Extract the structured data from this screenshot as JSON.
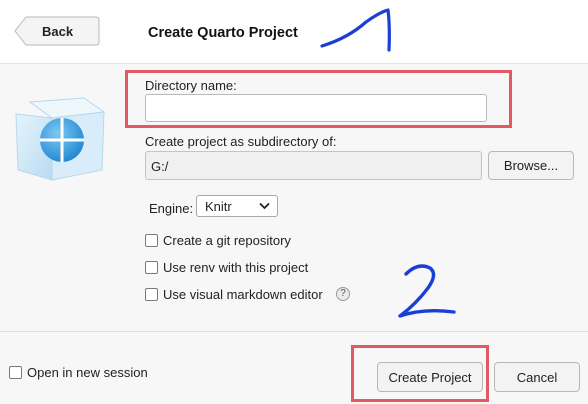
{
  "header": {
    "back_label": "Back",
    "title": "Create Quarto Project"
  },
  "form": {
    "directory_label": "Directory name:",
    "directory_value": "",
    "subdir_label": "Create project as subdirectory of:",
    "subdir_value": "G:/",
    "browse_label": "Browse...",
    "engine_label": "Engine:",
    "engine_value": "Knitr",
    "options": [
      {
        "label": "Create a git repository",
        "checked": false
      },
      {
        "label": "Use renv with this project",
        "checked": false
      },
      {
        "label": "Use visual markdown editor",
        "checked": false
      }
    ],
    "help_glyph": "?"
  },
  "footer": {
    "new_session_label": "Open in new session",
    "create_label": "Create Project",
    "cancel_label": "Cancel"
  },
  "annotations": {
    "step_1": "1",
    "step_2": "2",
    "highlight_color": "#e05a63",
    "ink_color": "#1b3fd6"
  },
  "icons": [
    "quarto-cube-icon",
    "chevron-down-icon",
    "help-icon"
  ]
}
